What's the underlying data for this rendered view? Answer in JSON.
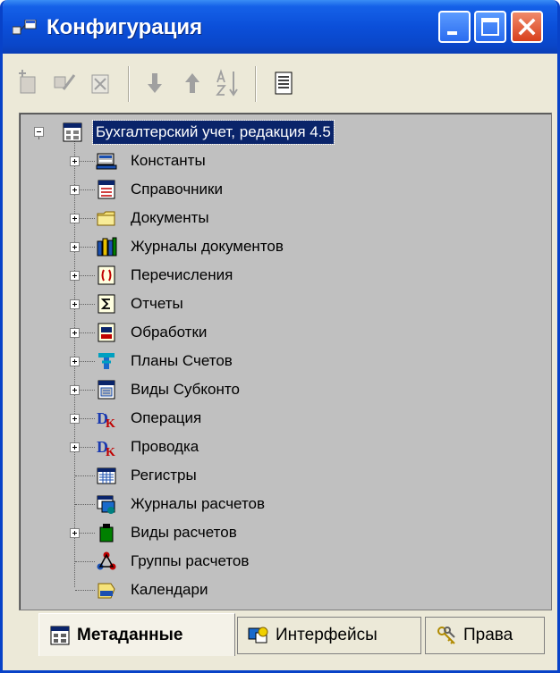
{
  "window": {
    "title": "Конфигурация"
  },
  "tree": {
    "root": "Бухгалтерский учет, редакция 4.5",
    "items": [
      {
        "label": "Константы",
        "icon": "constants-icon",
        "expandable": true
      },
      {
        "label": "Справочники",
        "icon": "catalogs-icon",
        "expandable": true
      },
      {
        "label": "Документы",
        "icon": "folder-icon",
        "expandable": true
      },
      {
        "label": "Журналы документов",
        "icon": "document-journals-icon",
        "expandable": true
      },
      {
        "label": "Перечисления",
        "icon": "enumerations-icon",
        "expandable": true
      },
      {
        "label": "Отчеты",
        "icon": "reports-icon",
        "expandable": true
      },
      {
        "label": "Обработки",
        "icon": "processing-icon",
        "expandable": true
      },
      {
        "label": "Планы Счетов",
        "icon": "chart-of-accounts-icon",
        "expandable": true
      },
      {
        "label": "Виды Субконто",
        "icon": "subconto-types-icon",
        "expandable": true
      },
      {
        "label": "Операция",
        "icon": "operation-icon",
        "expandable": true
      },
      {
        "label": "Проводка",
        "icon": "posting-icon",
        "expandable": true
      },
      {
        "label": "Регистры",
        "icon": "registers-icon",
        "expandable": false
      },
      {
        "label": "Журналы расчетов",
        "icon": "calculation-journals-icon",
        "expandable": false
      },
      {
        "label": "Виды расчетов",
        "icon": "calculation-types-icon",
        "expandable": true
      },
      {
        "label": "Группы расчетов",
        "icon": "calculation-groups-icon",
        "expandable": false
      },
      {
        "label": "Календари",
        "icon": "calendars-icon",
        "expandable": false
      }
    ]
  },
  "tabs": [
    {
      "label": "Метаданные",
      "active": true
    },
    {
      "label": "Интерфейсы",
      "active": false
    },
    {
      "label": "Права",
      "active": false
    }
  ],
  "colors": {
    "titlebar": "#0a46c8",
    "panel": "#c0c0c0",
    "selection": "#0a246a",
    "window": "#ece9d8"
  }
}
